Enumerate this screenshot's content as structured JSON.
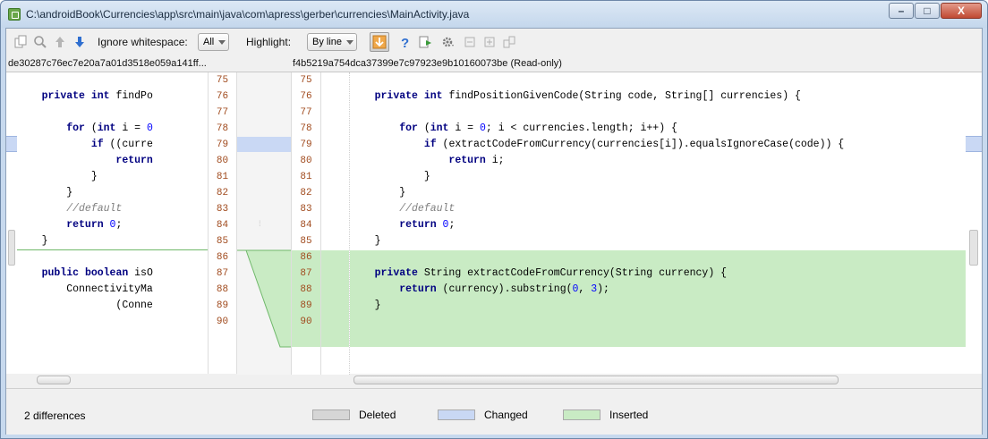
{
  "window": {
    "title": "C:\\androidBook\\Currencies\\app\\src\\main\\java\\com\\apress\\gerber\\currencies\\MainActivity.java",
    "minimize_glyph": "–",
    "maximize_glyph": "□",
    "close_glyph": "X"
  },
  "toolbar": {
    "ignore_whitespace_label": "Ignore whitespace:",
    "ignore_whitespace_value": "All",
    "highlight_label": "Highlight:",
    "highlight_value": "By line"
  },
  "revisions": {
    "left": "de30287c76ec7e20a7a01d3518e059a141ff...",
    "right": "f4b5219a754dca37399e7c97923e9b10160073be (Read-only)"
  },
  "left_numbers": [
    "75",
    "76",
    "77",
    "78",
    "79",
    "80",
    "81",
    "82",
    "83",
    "84",
    "85",
    "86",
    "87",
    "88",
    "89",
    "90"
  ],
  "right_numbers": [
    "75",
    "76",
    "77",
    "78",
    "79",
    "80",
    "81",
    "82",
    "83",
    "84",
    "85",
    "86",
    "87",
    "88",
    "89",
    "90"
  ],
  "left_lines": [
    "",
    "    private int findPo",
    "",
    "        for (int i = 0",
    "            if ((curre",
    "                return",
    "            }",
    "        }",
    "        //default",
    "        return 0;",
    "    }",
    "",
    "    public boolean isO",
    "        ConnectivityMa",
    "                (Conne",
    ""
  ],
  "right_lines": [
    "",
    "    private int findPositionGivenCode(String code, String[] currencies) {",
    "",
    "        for (int i = 0; i < currencies.length; i++) {",
    "            if (extractCodeFromCurrency(currencies[i]).equalsIgnoreCase(code)) {",
    "                return i;",
    "            }",
    "        }",
    "        //default",
    "        return 0;",
    "    }",
    "",
    "    private String extractCodeFromCurrency(String currency) {",
    "        return (currency).substring(0, 3);",
    "    }",
    ""
  ],
  "status": {
    "differences": "2 differences",
    "legend": [
      {
        "label": "Deleted",
        "color": "#d6d6d6"
      },
      {
        "label": "Changed",
        "color": "#c9d8f4"
      },
      {
        "label": "Inserted",
        "color": "#c9ebc4"
      }
    ]
  }
}
